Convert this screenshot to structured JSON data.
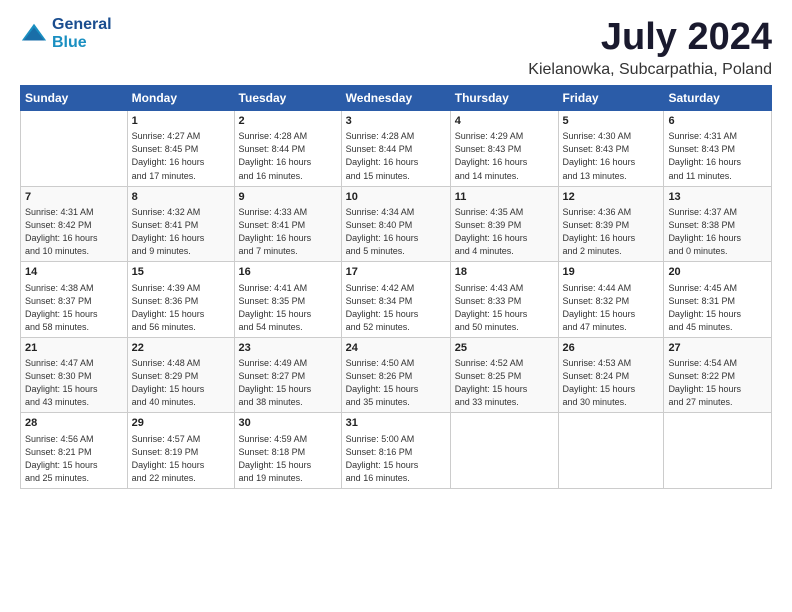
{
  "header": {
    "logo_line1": "General",
    "logo_line2": "Blue",
    "title": "July 2024",
    "subtitle": "Kielanowka, Subcarpathia, Poland"
  },
  "calendar": {
    "days_of_week": [
      "Sunday",
      "Monday",
      "Tuesday",
      "Wednesday",
      "Thursday",
      "Friday",
      "Saturday"
    ],
    "weeks": [
      [
        {
          "day": "",
          "content": ""
        },
        {
          "day": "1",
          "content": "Sunrise: 4:27 AM\nSunset: 8:45 PM\nDaylight: 16 hours\nand 17 minutes."
        },
        {
          "day": "2",
          "content": "Sunrise: 4:28 AM\nSunset: 8:44 PM\nDaylight: 16 hours\nand 16 minutes."
        },
        {
          "day": "3",
          "content": "Sunrise: 4:28 AM\nSunset: 8:44 PM\nDaylight: 16 hours\nand 15 minutes."
        },
        {
          "day": "4",
          "content": "Sunrise: 4:29 AM\nSunset: 8:43 PM\nDaylight: 16 hours\nand 14 minutes."
        },
        {
          "day": "5",
          "content": "Sunrise: 4:30 AM\nSunset: 8:43 PM\nDaylight: 16 hours\nand 13 minutes."
        },
        {
          "day": "6",
          "content": "Sunrise: 4:31 AM\nSunset: 8:43 PM\nDaylight: 16 hours\nand 11 minutes."
        }
      ],
      [
        {
          "day": "7",
          "content": "Sunrise: 4:31 AM\nSunset: 8:42 PM\nDaylight: 16 hours\nand 10 minutes."
        },
        {
          "day": "8",
          "content": "Sunrise: 4:32 AM\nSunset: 8:41 PM\nDaylight: 16 hours\nand 9 minutes."
        },
        {
          "day": "9",
          "content": "Sunrise: 4:33 AM\nSunset: 8:41 PM\nDaylight: 16 hours\nand 7 minutes."
        },
        {
          "day": "10",
          "content": "Sunrise: 4:34 AM\nSunset: 8:40 PM\nDaylight: 16 hours\nand 5 minutes."
        },
        {
          "day": "11",
          "content": "Sunrise: 4:35 AM\nSunset: 8:39 PM\nDaylight: 16 hours\nand 4 minutes."
        },
        {
          "day": "12",
          "content": "Sunrise: 4:36 AM\nSunset: 8:39 PM\nDaylight: 16 hours\nand 2 minutes."
        },
        {
          "day": "13",
          "content": "Sunrise: 4:37 AM\nSunset: 8:38 PM\nDaylight: 16 hours\nand 0 minutes."
        }
      ],
      [
        {
          "day": "14",
          "content": "Sunrise: 4:38 AM\nSunset: 8:37 PM\nDaylight: 15 hours\nand 58 minutes."
        },
        {
          "day": "15",
          "content": "Sunrise: 4:39 AM\nSunset: 8:36 PM\nDaylight: 15 hours\nand 56 minutes."
        },
        {
          "day": "16",
          "content": "Sunrise: 4:41 AM\nSunset: 8:35 PM\nDaylight: 15 hours\nand 54 minutes."
        },
        {
          "day": "17",
          "content": "Sunrise: 4:42 AM\nSunset: 8:34 PM\nDaylight: 15 hours\nand 52 minutes."
        },
        {
          "day": "18",
          "content": "Sunrise: 4:43 AM\nSunset: 8:33 PM\nDaylight: 15 hours\nand 50 minutes."
        },
        {
          "day": "19",
          "content": "Sunrise: 4:44 AM\nSunset: 8:32 PM\nDaylight: 15 hours\nand 47 minutes."
        },
        {
          "day": "20",
          "content": "Sunrise: 4:45 AM\nSunset: 8:31 PM\nDaylight: 15 hours\nand 45 minutes."
        }
      ],
      [
        {
          "day": "21",
          "content": "Sunrise: 4:47 AM\nSunset: 8:30 PM\nDaylight: 15 hours\nand 43 minutes."
        },
        {
          "day": "22",
          "content": "Sunrise: 4:48 AM\nSunset: 8:29 PM\nDaylight: 15 hours\nand 40 minutes."
        },
        {
          "day": "23",
          "content": "Sunrise: 4:49 AM\nSunset: 8:27 PM\nDaylight: 15 hours\nand 38 minutes."
        },
        {
          "day": "24",
          "content": "Sunrise: 4:50 AM\nSunset: 8:26 PM\nDaylight: 15 hours\nand 35 minutes."
        },
        {
          "day": "25",
          "content": "Sunrise: 4:52 AM\nSunset: 8:25 PM\nDaylight: 15 hours\nand 33 minutes."
        },
        {
          "day": "26",
          "content": "Sunrise: 4:53 AM\nSunset: 8:24 PM\nDaylight: 15 hours\nand 30 minutes."
        },
        {
          "day": "27",
          "content": "Sunrise: 4:54 AM\nSunset: 8:22 PM\nDaylight: 15 hours\nand 27 minutes."
        }
      ],
      [
        {
          "day": "28",
          "content": "Sunrise: 4:56 AM\nSunset: 8:21 PM\nDaylight: 15 hours\nand 25 minutes."
        },
        {
          "day": "29",
          "content": "Sunrise: 4:57 AM\nSunset: 8:19 PM\nDaylight: 15 hours\nand 22 minutes."
        },
        {
          "day": "30",
          "content": "Sunrise: 4:59 AM\nSunset: 8:18 PM\nDaylight: 15 hours\nand 19 minutes."
        },
        {
          "day": "31",
          "content": "Sunrise: 5:00 AM\nSunset: 8:16 PM\nDaylight: 15 hours\nand 16 minutes."
        },
        {
          "day": "",
          "content": ""
        },
        {
          "day": "",
          "content": ""
        },
        {
          "day": "",
          "content": ""
        }
      ]
    ]
  }
}
